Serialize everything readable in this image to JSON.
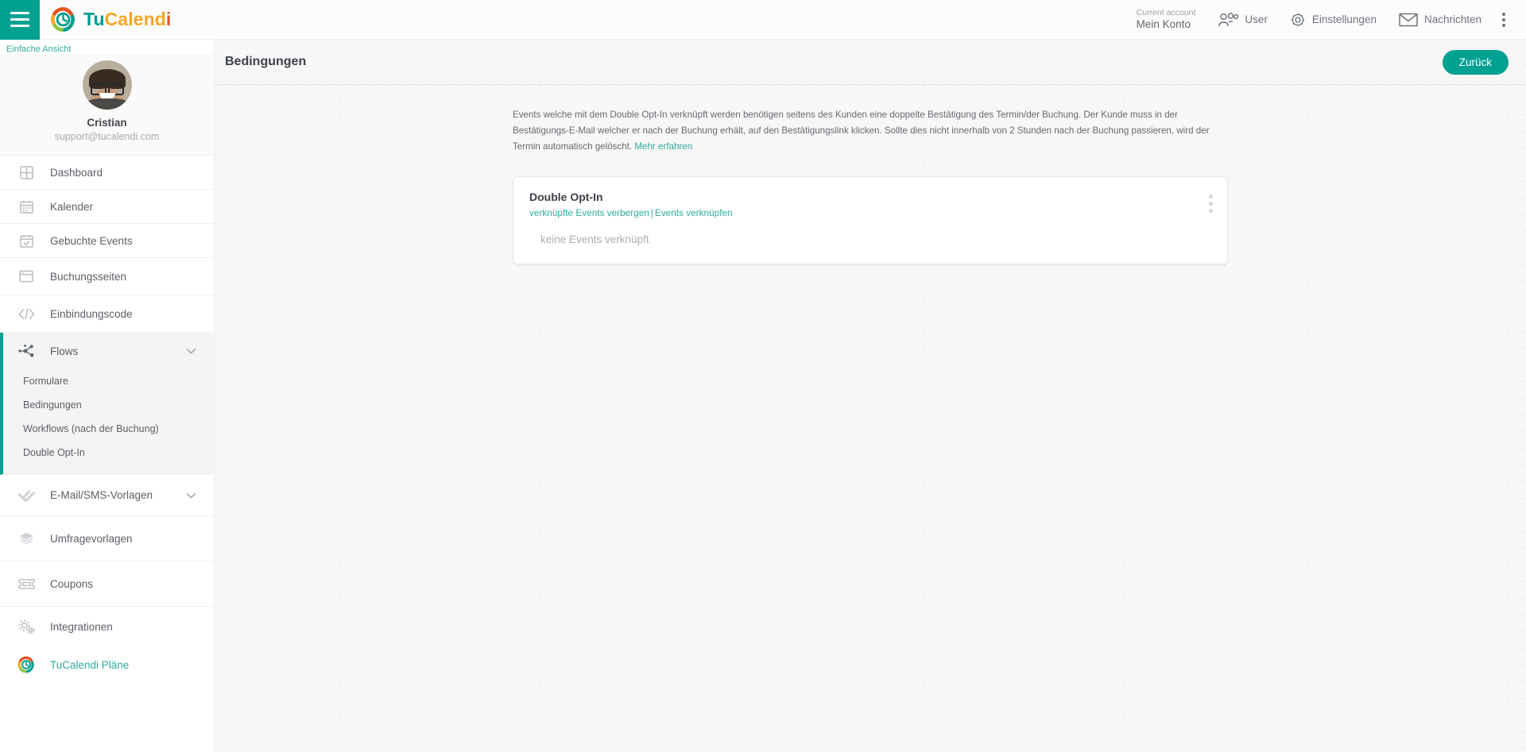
{
  "topbar": {
    "menu_icon": "hamburger-icon",
    "brand": {
      "part1": "Tu",
      "part2": "Calend",
      "part3": "i",
      "logo_icon": "tucalendi-logo-icon"
    },
    "account": {
      "caption": "Current account",
      "name": "Mein Konto"
    },
    "items": [
      {
        "label": "User",
        "icon": "users-icon"
      },
      {
        "label": "Einstellungen",
        "icon": "gear-icon"
      },
      {
        "label": "Nachrichten",
        "icon": "envelope-icon"
      }
    ],
    "overflow_icon": "kebab-vertical-icon"
  },
  "sidebar": {
    "simple_view": "Einfache Ansicht",
    "profile": {
      "name": "Cristian",
      "email": "support@tucalendi.com",
      "avatar": "user-avatar"
    },
    "items": [
      {
        "label": "Dashboard",
        "icon": "grid-icon"
      },
      {
        "label": "Kalender",
        "icon": "calendar-icon"
      },
      {
        "label": "Gebuchte Events",
        "icon": "calendar-check-icon"
      },
      {
        "label": "Buchungsseiten",
        "icon": "window-icon"
      },
      {
        "label": "Einbindungscode",
        "icon": "code-icon"
      }
    ],
    "flows": {
      "label": "Flows",
      "icon": "nodes-icon",
      "chevron": "chevron-down-icon",
      "expanded": true,
      "sub_items": [
        {
          "label": "Formulare"
        },
        {
          "label": "Bedingungen"
        },
        {
          "label": "Workflows (nach der Buchung)"
        },
        {
          "label": "Double Opt-In"
        }
      ]
    },
    "templates": {
      "label": "E-Mail/SMS-Vorlagen",
      "icon": "double-check-icon",
      "chevron": "chevron-down-icon"
    },
    "items_bottom": [
      {
        "label": "Umfragevorlagen",
        "icon": "layers-icon"
      },
      {
        "label": "Coupons",
        "icon": "ticket-icon"
      },
      {
        "label": "Integrationen",
        "icon": "gears-icon"
      }
    ],
    "plans": {
      "label": "TuCalendi Pläne",
      "icon": "tucalendi-logo-icon"
    }
  },
  "main": {
    "page_title": "Bedingungen",
    "back_button": "Zurück",
    "description": {
      "text": "Events welche mit dem Double Opt-In verknüpft werden benötigen seitens des Kunden eine doppelte Bestätigung des Termin/der Buchung. Der Kunde muss in der Bestätigungs-E-Mail welcher er nach der Buchung erhält, auf den Bestätigungslink klicken. Sollte dies nicht innerhalb von 2 Stunden nach der Buchung passieren, wird der Termin automatisch gelöscht. ",
      "link": "Mehr erfahren"
    },
    "card": {
      "title": "Double Opt-In",
      "link_hide": "verknüpfte Events verbergen",
      "separator": "|",
      "link_connect": "Events verknüpfen",
      "empty_text": "keine Events verknüpft",
      "menu_icon": "kebab-vertical-icon"
    }
  },
  "colors": {
    "accent": "#00a191",
    "link": "#2fab9c",
    "logo_orange": "#f5a623",
    "logo_red": "#e8521f"
  }
}
